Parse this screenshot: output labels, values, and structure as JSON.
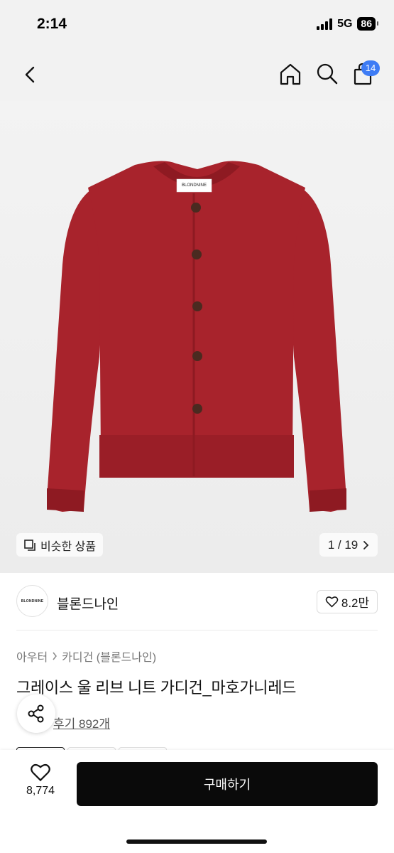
{
  "status_bar": {
    "time": "2:14",
    "network": "5G",
    "battery": "86"
  },
  "nav": {
    "cart_count": "14"
  },
  "gallery": {
    "label_tag": "BLONDNINE",
    "similar_label": "비슷한 상품",
    "pager": "1 / 19",
    "colors": {
      "body": "#a8232c",
      "dark": "#8e1a22",
      "button": "#4a2a20",
      "background": "#efefef"
    }
  },
  "brand": {
    "logo_text": "BLONDNINE",
    "name": "블론드나인",
    "likes": "8.2만"
  },
  "product": {
    "breadcrumb": [
      "아우터",
      "카디건 (블론드나인)"
    ],
    "title": "그레이스 울 리브 니트 가디건_마호가니레드",
    "reviews": "후기 892개"
  },
  "bottom": {
    "wish_count": "8,774",
    "buy_label": "구매하기"
  }
}
